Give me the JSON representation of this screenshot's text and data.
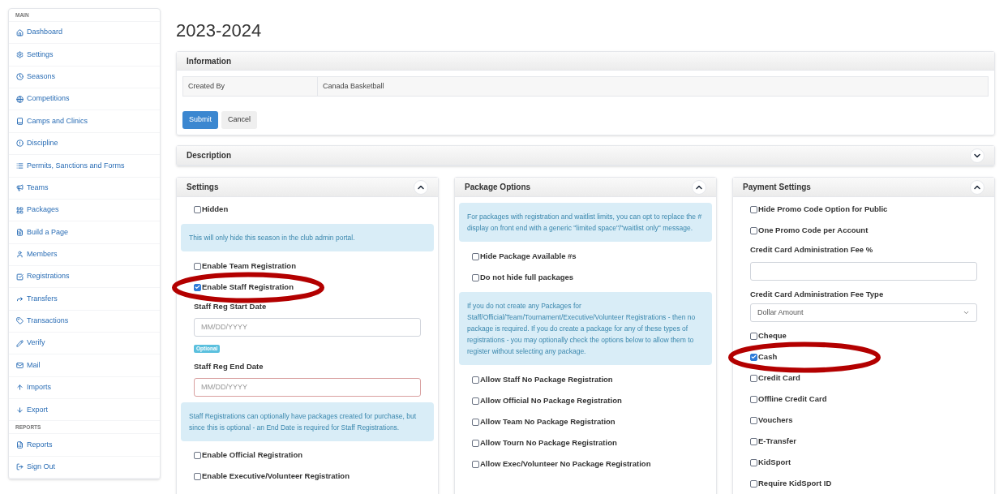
{
  "sidebar": {
    "sections": [
      {
        "heading": "MAIN",
        "items": [
          {
            "label": "Dashboard"
          },
          {
            "label": "Settings"
          },
          {
            "label": "Seasons"
          },
          {
            "label": "Competitions"
          },
          {
            "label": "Camps and Clinics"
          },
          {
            "label": "Discipline"
          },
          {
            "label": "Permits, Sanctions and Forms"
          },
          {
            "label": "Teams"
          },
          {
            "label": "Packages"
          },
          {
            "label": "Build a Page"
          },
          {
            "label": "Members"
          },
          {
            "label": "Registrations"
          },
          {
            "label": "Transfers"
          },
          {
            "label": "Transactions"
          },
          {
            "label": "Verify"
          },
          {
            "label": "Mail"
          },
          {
            "label": "Imports"
          },
          {
            "label": "Export"
          }
        ]
      },
      {
        "heading": "REPORTS",
        "items": [
          {
            "label": "Reports"
          },
          {
            "label": "Sign Out"
          }
        ]
      }
    ]
  },
  "title": "2023-2024",
  "information": {
    "title": "Information",
    "rows": [
      {
        "label": "Created By",
        "value": "Canada Basketball"
      }
    ],
    "buttons": [
      {
        "label": "Submit",
        "kind": "primary"
      },
      {
        "label": "Cancel",
        "kind": "default"
      }
    ]
  },
  "description": {
    "title": "Description",
    "expanded": false
  },
  "columns": [
    {
      "title": "Settings",
      "expanded": true,
      "items": [
        {
          "kind": "checkbox",
          "label": "Hidden",
          "checked": false,
          "circled": false
        },
        {
          "kind": "info",
          "text": "This will only hide this season in the club admin portal."
        },
        {
          "kind": "checkbox",
          "label": "Enable Team Registration",
          "checked": false,
          "circled": false
        },
        {
          "kind": "checkbox",
          "label": "Enable Staff Registration",
          "checked": true,
          "circled": true
        },
        {
          "kind": "date",
          "label": "Staff Reg Start Date",
          "placeholder": "MM/DD/YYYY",
          "badge": "Optional",
          "invalid": false
        },
        {
          "kind": "date",
          "label": "Staff Reg End Date",
          "placeholder": "MM/DD/YYYY",
          "invalid": true
        },
        {
          "kind": "info",
          "text": "Staff Registrations can optionally have packages created for purchase, but since this is optional - an End Date is required for Staff Registrations."
        },
        {
          "kind": "checkbox",
          "label": "Enable Official Registration",
          "checked": false,
          "circled": false
        },
        {
          "kind": "checkbox",
          "label": "Enable Executive/Volunteer Registration",
          "checked": false,
          "circled": false
        }
      ]
    },
    {
      "title": "Package Options",
      "expanded": true,
      "items": [
        {
          "kind": "info",
          "text": "For packages with registration and waitlist limits, you can opt to replace the # display on front end with a generic \"limited space\"/\"waitlist only\" message."
        },
        {
          "kind": "checkbox",
          "label": "Hide Package Available #s",
          "checked": false,
          "circled": false
        },
        {
          "kind": "checkbox",
          "label": "Do not hide full packages",
          "checked": false,
          "circled": false
        },
        {
          "kind": "info",
          "text": "If you do not create any Packages for Staff/Official/Team/Tournament/Executive/Volunteer Registrations - then no package is required. If you do create a package for any of these types of registrations - you may optionally check the options below to allow them to register without selecting any package."
        },
        {
          "kind": "checkbox",
          "label": "Allow Staff No Package Registration",
          "checked": false,
          "circled": false
        },
        {
          "kind": "checkbox",
          "label": "Allow Official No Package Registration",
          "checked": false,
          "circled": false
        },
        {
          "kind": "checkbox",
          "label": "Allow Team No Package Registration",
          "checked": false,
          "circled": false
        },
        {
          "kind": "checkbox",
          "label": "Allow Tourn No Package Registration",
          "checked": false,
          "circled": false
        },
        {
          "kind": "checkbox",
          "label": "Allow Exec/Volunteer No Package Registration",
          "checked": false,
          "circled": false
        }
      ]
    },
    {
      "title": "Payment Settings",
      "expanded": true,
      "items": [
        {
          "kind": "checkbox",
          "label": "Hide Promo Code Option for Public",
          "checked": false,
          "circled": false
        },
        {
          "kind": "checkbox",
          "label": "One Promo Code per Account",
          "checked": false,
          "circled": false
        },
        {
          "kind": "text",
          "label": "Credit Card Administration Fee %"
        },
        {
          "kind": "select",
          "label": "Credit Card Administration Fee Type",
          "value": "Dollar Amount"
        },
        {
          "kind": "checkbox",
          "label": "Cheque",
          "checked": false,
          "circled": false
        },
        {
          "kind": "checkbox",
          "label": "Cash",
          "checked": true,
          "circled": true
        },
        {
          "kind": "checkbox",
          "label": "Credit Card",
          "checked": false,
          "circled": false
        },
        {
          "kind": "checkbox",
          "label": "Offline Credit Card",
          "checked": false,
          "circled": false
        },
        {
          "kind": "checkbox",
          "label": "Vouchers",
          "checked": false,
          "circled": false
        },
        {
          "kind": "checkbox",
          "label": "E-Transfer",
          "checked": false,
          "circled": false
        },
        {
          "kind": "checkbox",
          "label": "KidSport",
          "checked": false,
          "circled": false
        },
        {
          "kind": "checkbox",
          "label": "Require KidSport ID",
          "checked": false,
          "circled": false
        }
      ]
    }
  ]
}
